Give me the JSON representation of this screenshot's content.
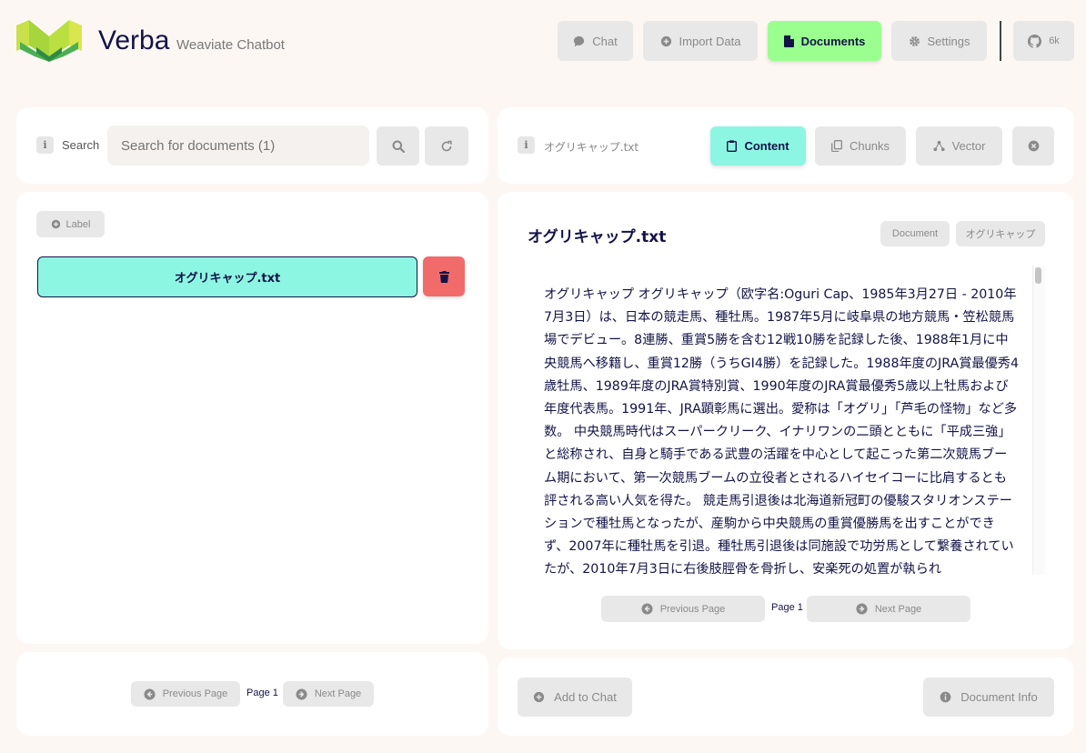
{
  "app": {
    "title": "Verba",
    "subtitle": "Weaviate Chatbot"
  },
  "nav": {
    "chat": "Chat",
    "import": "Import Data",
    "documents": "Documents",
    "settings": "Settings",
    "github_count": "6k"
  },
  "search": {
    "label": "Search",
    "placeholder": "Search for documents (1)"
  },
  "labels": {
    "add_label": "Label"
  },
  "documents": [
    {
      "name": "オグリキャップ.txt",
      "selected": true
    }
  ],
  "left_pagination": {
    "prev": "Previous Page",
    "page": "Page 1",
    "next": "Next Page"
  },
  "viewer": {
    "filename": "オグリキャップ.txt",
    "tabs": {
      "content": "Content",
      "chunks": "Chunks",
      "vector": "Vector"
    },
    "title": "オグリキャップ.txt",
    "tags": [
      "Document",
      "オグリキャップ"
    ],
    "content": "オグリキャップ オグリキャップ（欧字名:Oguri Cap、1985年3月27日 - 2010年7月3日）は、日本の競走馬、種牡馬。1987年5月に岐阜県の地方競馬・笠松競馬場でデビュー。8連勝、重賞5勝を含む12戦10勝を記録した後、1988年1月に中央競馬へ移籍し、重賞12勝（うちGI4勝）を記録した。1988年度のJRA賞最優秀4歳牡馬、1989年度のJRA賞特別賞、1990年度のJRA賞最優秀5歳以上牡馬および年度代表馬。1991年、JRA顕彰馬に選出。愛称は「オグリ」「芦毛の怪物」など多数。 中央競馬時代はスーパークリーク、イナリワンの二頭とともに「平成三強」と総称され、自身と騎手である武豊の活躍を中心として起こった第二次競馬ブーム期において、第一次競馬ブームの立役者とされるハイセイコーに比肩するとも評される高い人気を得た。 競走馬引退後は北海道新冠町の優駿スタリオンステーションで種牡馬となったが、産駒から中央競馬の重賞優勝馬を出すことができず、2007年に種牡馬を引退。種牡馬引退後は同施設で功労馬として繋養されていたが、2010年7月3日に右後肢脛骨を骨折し、安楽死の処置が執られ",
    "pagination": {
      "prev": "Previous Page",
      "page": "Page 1",
      "next": "Next Page"
    }
  },
  "footer": {
    "add_to_chat": "Add to Chat",
    "document_info": "Document Info"
  },
  "colors": {
    "background": "#fdf7f4",
    "accent_green": "#9bff8f",
    "accent_teal": "#8df6e2",
    "delete_red": "#f26b6b",
    "text_navy": "#131347"
  }
}
